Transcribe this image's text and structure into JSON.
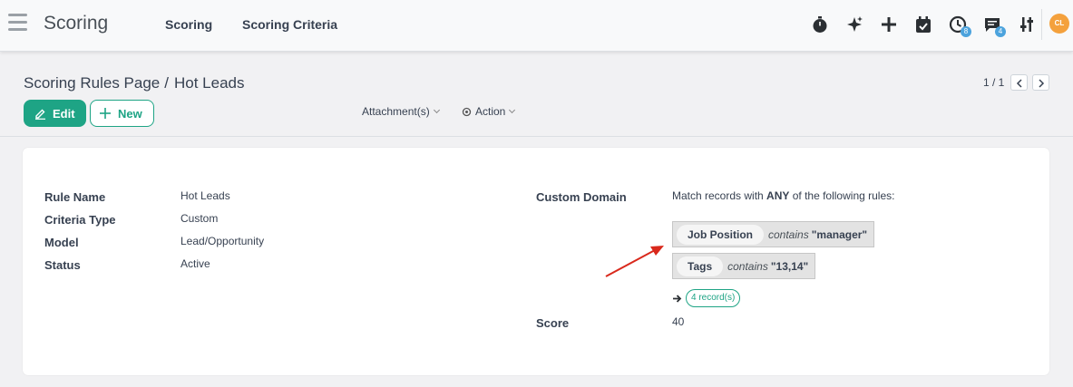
{
  "app": {
    "title": "Scoring"
  },
  "menu": [
    {
      "label": "Scoring"
    },
    {
      "label": "Scoring Criteria"
    }
  ],
  "systray": {
    "icons": [
      "stopwatch-icon",
      "sparkle-icon",
      "plus-icon",
      "calendar-check-icon",
      "clock-icon",
      "chat-icon",
      "sliders-icon"
    ],
    "activity_count": "8",
    "message_count": "4",
    "user_initials": "CL"
  },
  "breadcrumb": {
    "parent": "Scoring Rules Page",
    "separator": "/",
    "current": "Hot Leads"
  },
  "buttons": {
    "edit": "Edit",
    "new": "New"
  },
  "actions": {
    "attachments": "Attachment(s)",
    "action": "Action"
  },
  "pager": {
    "value": "1 / 1"
  },
  "form": {
    "rule_name": {
      "label": "Rule Name",
      "value": "Hot Leads"
    },
    "criteria_type": {
      "label": "Criteria Type",
      "value": "Custom"
    },
    "model": {
      "label": "Model",
      "value": "Lead/Opportunity"
    },
    "status": {
      "label": "Status",
      "value": "Active"
    },
    "custom_domain": {
      "label": "Custom Domain",
      "desc_prefix": "Match records with",
      "desc_keyword": "ANY",
      "desc_suffix": "of the following rules:",
      "rules": [
        {
          "field": "Job Position",
          "operator": "contains",
          "value": "\"manager\""
        },
        {
          "field": "Tags",
          "operator": "contains",
          "value": "\"13,14\""
        }
      ],
      "records": "4 record(s)"
    },
    "score": {
      "label": "Score",
      "value": "40"
    }
  },
  "colors": {
    "primary": "#1ea485",
    "badge": "#4ca3dd",
    "avatar": "#f4a13d",
    "annotation_arrow": "#d9291c"
  }
}
